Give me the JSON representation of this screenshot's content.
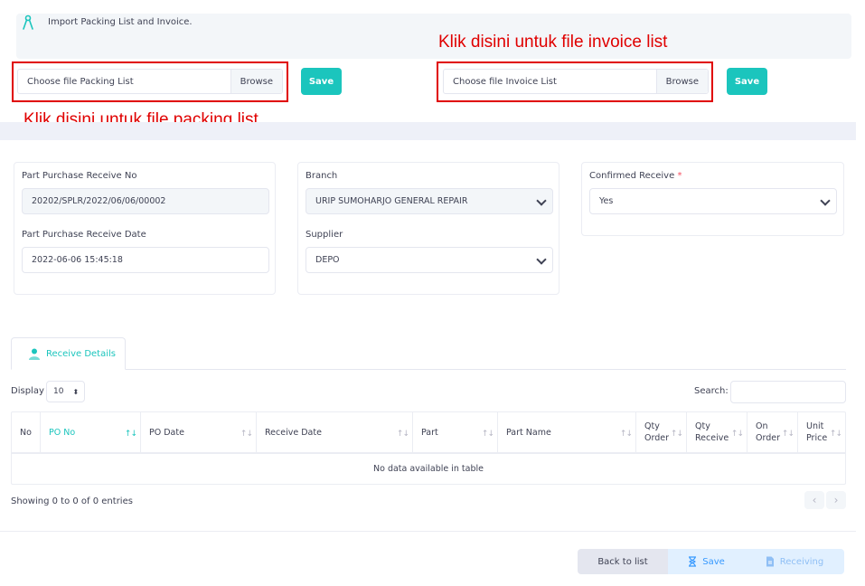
{
  "banner": {
    "text": "Import Packing List and Invoice."
  },
  "packing": {
    "placeholder": "Choose file Packing List",
    "browse": "Browse",
    "save": "Save"
  },
  "invoice": {
    "placeholder": "Choose file Invoice List",
    "browse": "Browse",
    "save": "Save"
  },
  "annotations": {
    "invoice": "Klik disini untuk file invoice list",
    "packing": "Klik disini untuk file packing list"
  },
  "form": {
    "receive_no_label": "Part Purchase Receive No",
    "receive_no_value": "20202/SPLR/2022/06/06/00002",
    "receive_date_label": "Part Purchase Receive Date",
    "receive_date_value": "2022-06-06 15:45:18",
    "branch_label": "Branch",
    "branch_value": "URIP SUMOHARJO GENERAL REPAIR",
    "supplier_label": "Supplier",
    "supplier_value": "DEPO",
    "confirmed_label": "Confirmed Receive",
    "confirmed_required": "*",
    "confirmed_value": "Yes"
  },
  "tab": {
    "label": "Receive Details"
  },
  "table_controls": {
    "display_label": "Display",
    "display_value": "10",
    "search_label": "Search:"
  },
  "table": {
    "columns": [
      "No",
      "PO No",
      "PO Date",
      "Receive Date",
      "Part",
      "Part Name",
      "Qty Order",
      "Qty Receive",
      "On Order",
      "Unit Price"
    ],
    "empty_text": "No data available in table"
  },
  "info": {
    "showing": "Showing 0 to 0 of 0 entries"
  },
  "footer": {
    "back": "Back to list",
    "save": "Save",
    "receiving": "Receiving"
  },
  "colors": {
    "accent": "#1bc5bd",
    "annotation": "#e00000",
    "light": "#f3f6f9"
  }
}
